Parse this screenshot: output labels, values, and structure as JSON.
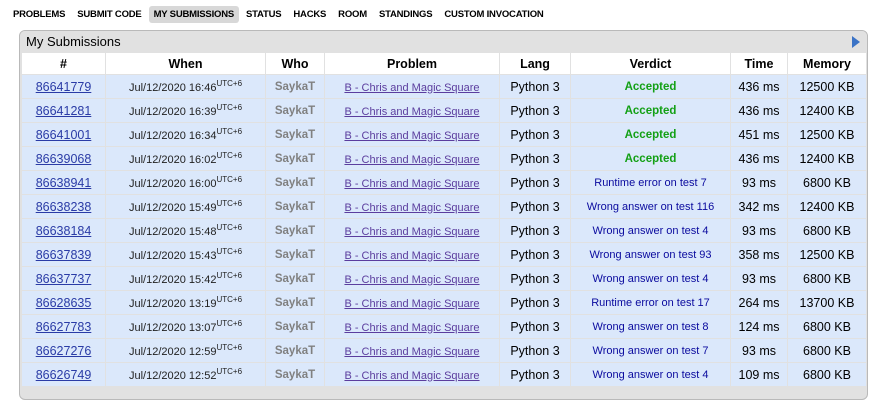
{
  "nav": {
    "items": [
      {
        "label": "PROBLEMS",
        "active": false
      },
      {
        "label": "SUBMIT CODE",
        "active": false
      },
      {
        "label": "MY SUBMISSIONS",
        "active": true
      },
      {
        "label": "STATUS",
        "active": false
      },
      {
        "label": "HACKS",
        "active": false
      },
      {
        "label": "ROOM",
        "active": false
      },
      {
        "label": "STANDINGS",
        "active": false
      },
      {
        "label": "CUSTOM INVOCATION",
        "active": false
      }
    ]
  },
  "panel": {
    "title": "My Submissions",
    "columns": [
      "#",
      "When",
      "Who",
      "Problem",
      "Lang",
      "Verdict",
      "Time",
      "Memory"
    ]
  },
  "submissions": [
    {
      "id": "86641779",
      "when": "Jul/12/2020 16:46",
      "tz": "UTC+6",
      "who": "SaykaT",
      "problem": "B - Chris and Magic Square",
      "lang": "Python 3",
      "verdict": "Accepted",
      "accepted": true,
      "time": "436 ms",
      "memory": "12500 KB"
    },
    {
      "id": "86641281",
      "when": "Jul/12/2020 16:39",
      "tz": "UTC+6",
      "who": "SaykaT",
      "problem": "B - Chris and Magic Square",
      "lang": "Python 3",
      "verdict": "Accepted",
      "accepted": true,
      "time": "436 ms",
      "memory": "12400 KB"
    },
    {
      "id": "86641001",
      "when": "Jul/12/2020 16:34",
      "tz": "UTC+6",
      "who": "SaykaT",
      "problem": "B - Chris and Magic Square",
      "lang": "Python 3",
      "verdict": "Accepted",
      "accepted": true,
      "time": "451 ms",
      "memory": "12500 KB"
    },
    {
      "id": "86639068",
      "when": "Jul/12/2020 16:02",
      "tz": "UTC+6",
      "who": "SaykaT",
      "problem": "B - Chris and Magic Square",
      "lang": "Python 3",
      "verdict": "Accepted",
      "accepted": true,
      "time": "436 ms",
      "memory": "12400 KB"
    },
    {
      "id": "86638941",
      "when": "Jul/12/2020 16:00",
      "tz": "UTC+6",
      "who": "SaykaT",
      "problem": "B - Chris and Magic Square",
      "lang": "Python 3",
      "verdict": "Runtime error on test 7",
      "accepted": false,
      "time": "93 ms",
      "memory": "6800 KB"
    },
    {
      "id": "86638238",
      "when": "Jul/12/2020 15:49",
      "tz": "UTC+6",
      "who": "SaykaT",
      "problem": "B - Chris and Magic Square",
      "lang": "Python 3",
      "verdict": "Wrong answer on test 116",
      "accepted": false,
      "time": "342 ms",
      "memory": "12400 KB"
    },
    {
      "id": "86638184",
      "when": "Jul/12/2020 15:48",
      "tz": "UTC+6",
      "who": "SaykaT",
      "problem": "B - Chris and Magic Square",
      "lang": "Python 3",
      "verdict": "Wrong answer on test 4",
      "accepted": false,
      "time": "93 ms",
      "memory": "6800 KB"
    },
    {
      "id": "86637839",
      "when": "Jul/12/2020 15:43",
      "tz": "UTC+6",
      "who": "SaykaT",
      "problem": "B - Chris and Magic Square",
      "lang": "Python 3",
      "verdict": "Wrong answer on test 93",
      "accepted": false,
      "time": "358 ms",
      "memory": "12500 KB"
    },
    {
      "id": "86637737",
      "when": "Jul/12/2020 15:42",
      "tz": "UTC+6",
      "who": "SaykaT",
      "problem": "B - Chris and Magic Square",
      "lang": "Python 3",
      "verdict": "Wrong answer on test 4",
      "accepted": false,
      "time": "93 ms",
      "memory": "6800 KB"
    },
    {
      "id": "86628635",
      "when": "Jul/12/2020 13:19",
      "tz": "UTC+6",
      "who": "SaykaT",
      "problem": "B - Chris and Magic Square",
      "lang": "Python 3",
      "verdict": "Runtime error on test 17",
      "accepted": false,
      "time": "264 ms",
      "memory": "13700 KB"
    },
    {
      "id": "86627783",
      "when": "Jul/12/2020 13:07",
      "tz": "UTC+6",
      "who": "SaykaT",
      "problem": "B - Chris and Magic Square",
      "lang": "Python 3",
      "verdict": "Wrong answer on test 8",
      "accepted": false,
      "time": "124 ms",
      "memory": "6800 KB"
    },
    {
      "id": "86627276",
      "when": "Jul/12/2020 12:59",
      "tz": "UTC+6",
      "who": "SaykaT",
      "problem": "B - Chris and Magic Square",
      "lang": "Python 3",
      "verdict": "Wrong answer on test 7",
      "accepted": false,
      "time": "93 ms",
      "memory": "6800 KB"
    },
    {
      "id": "86626749",
      "when": "Jul/12/2020 12:52",
      "tz": "UTC+6",
      "who": "SaykaT",
      "problem": "B - Chris and Magic Square",
      "lang": "Python 3",
      "verdict": "Wrong answer on test 4",
      "accepted": false,
      "time": "109 ms",
      "memory": "6800 KB"
    }
  ],
  "colors": {
    "row_bg": "#dbe8fb",
    "accepted": "#13a015",
    "verdict": "#0a0a9e",
    "link": "#2a3ba6",
    "problem_link": "#5b3d9e",
    "user": "#808080"
  }
}
